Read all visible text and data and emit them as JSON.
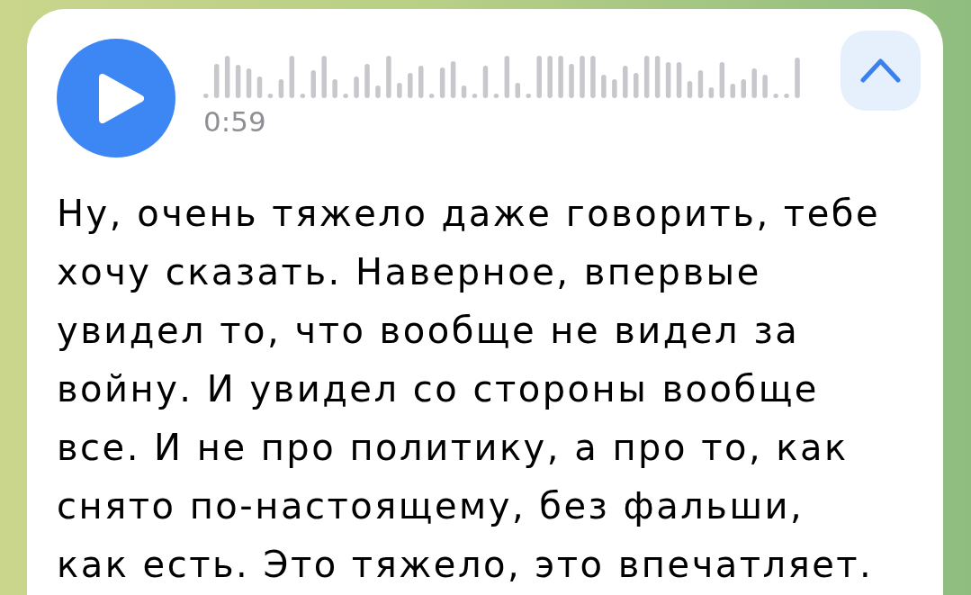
{
  "voice_message": {
    "duration": "0:59",
    "transcript_expanded": true,
    "transcript": "Ну, очень тяжело даже говорить, тебе хочу сказать. Наверное, впервые увидел то, что вообще не видел за войну. И увидел со стороны вообще все. И не про политику, а про то, как снято по-настоящему, без фальши, как есть. Это тяжело, это впечатляет."
  }
}
